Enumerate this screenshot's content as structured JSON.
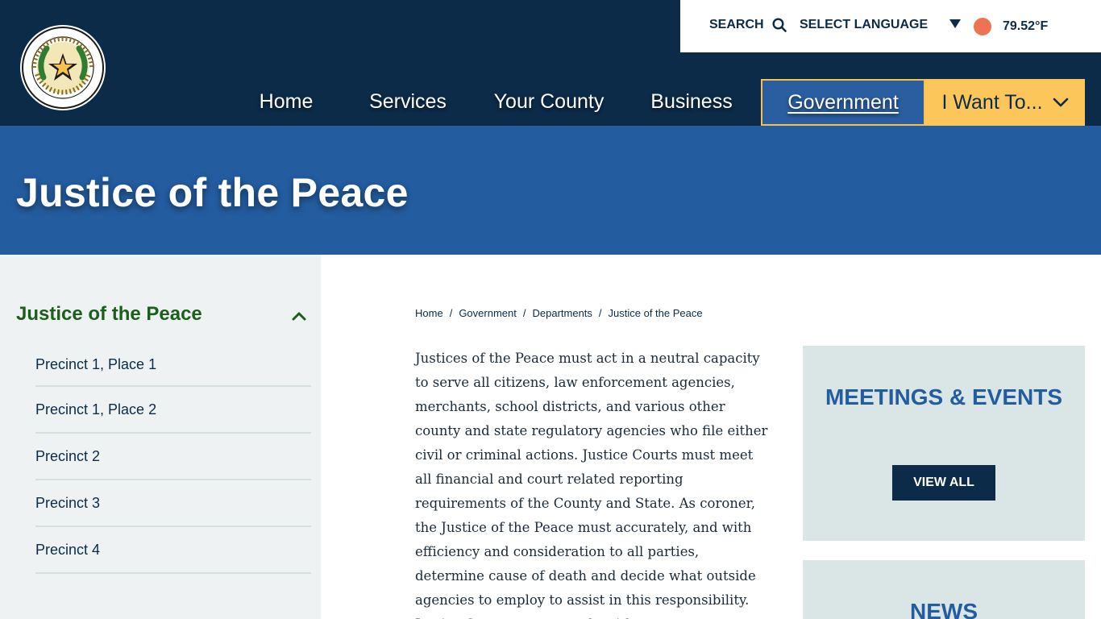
{
  "header": {
    "utility": {
      "search_label": "SEARCH",
      "language_label": "SELECT LANGUAGE",
      "temperature": "79.52°F"
    },
    "nav": {
      "home": "Home",
      "services": "Services",
      "your_county": "Your County",
      "business": "Business",
      "government": "Government",
      "i_want_to": "I Want To..."
    }
  },
  "banner": {
    "title": "Justice of the Peace"
  },
  "sidebar": {
    "heading": "Justice of the Peace",
    "items": [
      {
        "label": "Precinct 1, Place 1"
      },
      {
        "label": "Precinct 1, Place 2"
      },
      {
        "label": "Precinct 2"
      },
      {
        "label": "Precinct 3"
      },
      {
        "label": "Precinct 4"
      }
    ]
  },
  "breadcrumb": {
    "items": [
      "Home",
      "Government",
      "Departments",
      "Justice of the Peace"
    ],
    "separator": "/"
  },
  "content": {
    "paragraph": "Justices of the Peace must act in a neutral capacity to serve all citizens, law enforcement agencies, merchants, school districts, and various other county and state regulatory agencies who file either civil or criminal actions. Justice Courts must meet all financial and court related reporting requirements of the County and State. As coroner, the Justice of the Peace must accurately, and with efficiency and consideration to all parties, determine cause of death and decide what outside agencies to employ to assist in this responsibility. Justice Courts must comply with"
  },
  "cards": {
    "events": {
      "title": "MEETINGS & EVENTS",
      "button": "VIEW ALL"
    },
    "news": {
      "title": "NEWS"
    }
  },
  "colors": {
    "navy": "#0b2b49",
    "banner_blue": "#235c9f",
    "accent_yellow": "#fcc65b",
    "sidebar_green": "#1c5e1c",
    "card_bg": "#dae5e6"
  }
}
